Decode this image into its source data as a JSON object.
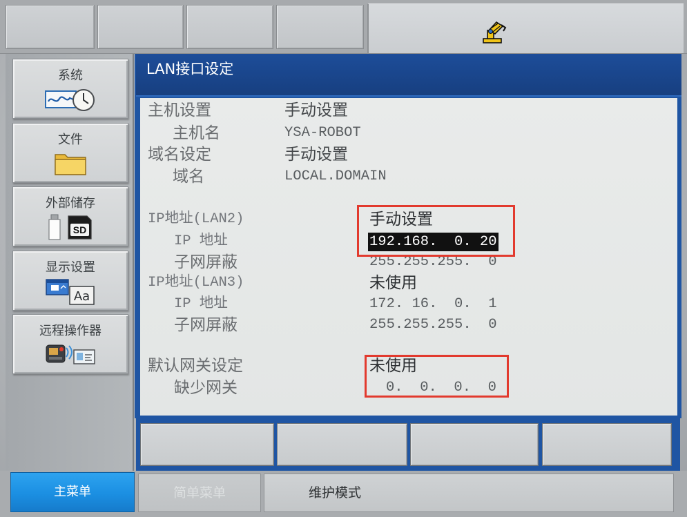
{
  "theme": {
    "frame_blue": "#1f55a3",
    "title_bar": "#1d4d99",
    "main_menu_blue": "#1b8fe2",
    "highlight_bg": "#111111",
    "highlight_text": "#ffffff",
    "annotation_red": "#e23a2e"
  },
  "top_bar": {
    "status_icon": "robot-status-icon"
  },
  "sidebar": {
    "items": [
      {
        "label": "系统",
        "icon": "system-clock-icon"
      },
      {
        "label": "文件",
        "icon": "folder-icon"
      },
      {
        "label": "外部储存",
        "icon": "usb-sd-card-icon",
        "icon_text": "SD"
      },
      {
        "label": "显示设置",
        "icon": "display-font-icon",
        "icon_text": "Aa"
      },
      {
        "label": "远程操作器",
        "icon": "remote-operator-icon"
      }
    ]
  },
  "main": {
    "title": "LAN接口设定",
    "host_settings": {
      "label": "主机设置",
      "value": "手动设置",
      "host_name": {
        "label": "主机名",
        "value": "YSA-ROBOT"
      }
    },
    "domain_settings": {
      "label": "域名设定",
      "value": "手动设置",
      "domain_name": {
        "label": "域名",
        "value": "LOCAL.DOMAIN"
      }
    },
    "lan2": {
      "label": "IP地址(LAN2)",
      "value": "手动设置",
      "ip_address": {
        "label": "IP 地址",
        "value": "192.168.  0. 20",
        "selected": true
      },
      "subnet_mask": {
        "label": "子网屏蔽",
        "value": "255.255.255.  0"
      }
    },
    "lan3": {
      "label": "IP地址(LAN3)",
      "value": "未使用",
      "ip_address": {
        "label": "IP 地址",
        "value": "172. 16.  0.  1"
      },
      "subnet_mask": {
        "label": "子网屏蔽",
        "value": "255.255.255.  0"
      }
    },
    "default_gateway": {
      "label": "默认网关设定",
      "value": "未使用",
      "gateway": {
        "label": "缺少网关",
        "value": "0.  0.  0.  0"
      }
    }
  },
  "bottom_bar": {
    "main_menu": "主菜单",
    "simple_menu": "简单菜单",
    "mode_status": "维护模式"
  }
}
